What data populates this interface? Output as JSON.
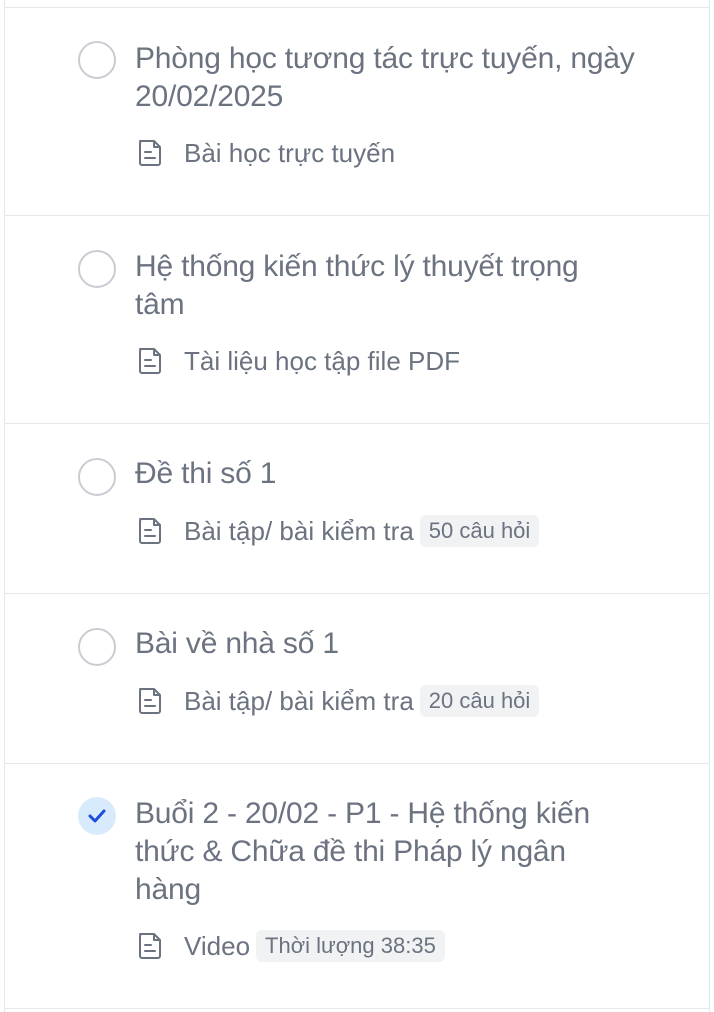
{
  "lessons": [
    {
      "title": "Phòng học tương tác trực tuyến, ngày 20/02/2025",
      "type": "Bài học trực tuyến",
      "badge": "",
      "completed": false,
      "icon": "document-icon"
    },
    {
      "title": "Hệ thống kiến thức lý thuyết trọng tâm",
      "type": "Tài liệu học tập file PDF",
      "badge": "",
      "completed": false,
      "icon": "document-icon"
    },
    {
      "title": "Đề thi số 1",
      "type": "Bài tập/ bài kiểm tra",
      "badge": "50 câu hỏi",
      "completed": false,
      "icon": "document-icon"
    },
    {
      "title": "Bài về nhà số 1",
      "type": "Bài tập/ bài kiểm tra",
      "badge": "20 câu hỏi",
      "completed": false,
      "icon": "document-icon"
    },
    {
      "title": "Buổi 2 - 20/02 - P1 - Hệ thống kiến thức & Chữa đề thi Pháp lý ngân hàng",
      "type": "Video",
      "badge": "Thời lượng 38:35",
      "completed": true,
      "icon": "document-icon"
    }
  ],
  "colors": {
    "text": "#6b7280",
    "divider": "#e5e7eb",
    "check_bg": "#d8ebfc",
    "check_mark": "#1d4ed8",
    "badge_bg": "#f1f2f4"
  }
}
